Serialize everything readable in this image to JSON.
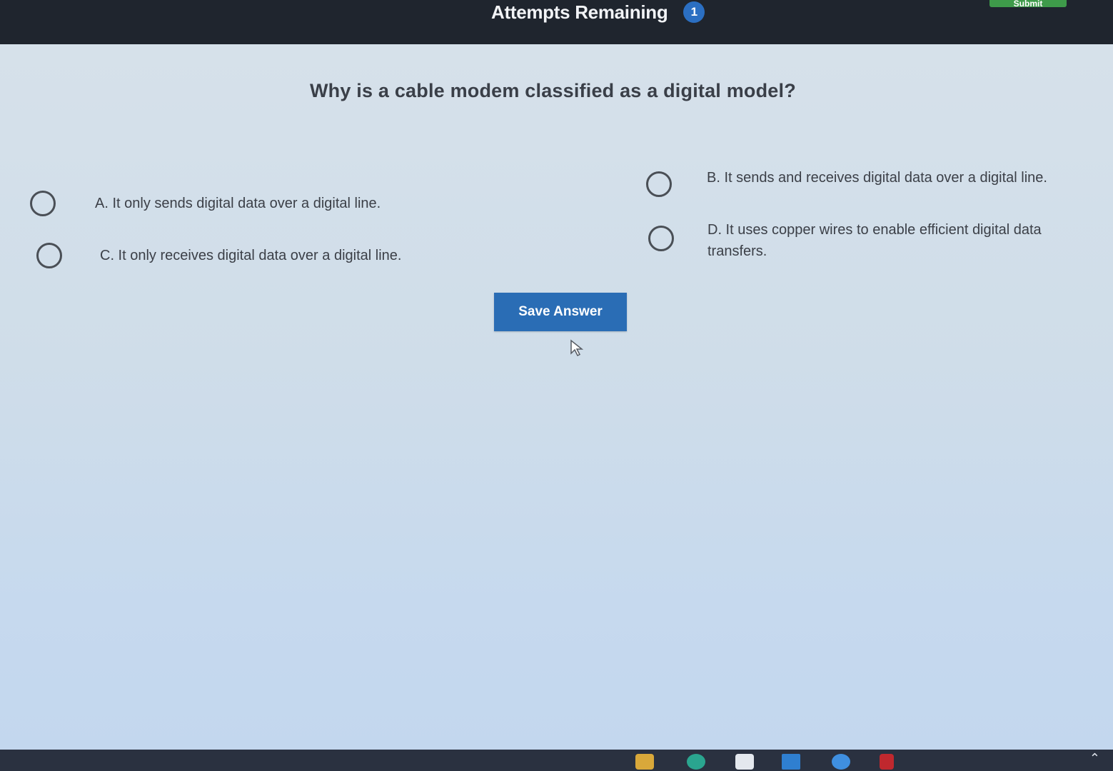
{
  "header": {
    "attempts_label": "Attempts Remaining",
    "attempts_count": "1",
    "submit_label": "Submit"
  },
  "question": {
    "text": "Why is a cable modem classified as a digital model?"
  },
  "options": [
    {
      "letter": "A",
      "text": "A. It only sends digital data over a digital line.",
      "selected": false
    },
    {
      "letter": "B",
      "text": "B. It sends and receives digital data over a digital line.",
      "selected": false
    },
    {
      "letter": "C",
      "text": "C. It only receives digital data over a digital line.",
      "selected": false
    },
    {
      "letter": "D",
      "text": "D. It uses copper wires to enable efficient digital data transfers.",
      "selected": false
    }
  ],
  "actions": {
    "save_label": "Save Answer"
  },
  "colors": {
    "header_bg": "#1f252e",
    "badge": "#2b6fc2",
    "submit": "#3e9b4a",
    "save_button": "#2a6db5",
    "content_bg": "#d3dfea"
  },
  "taskbar": {
    "icons": [
      "folder-icon",
      "edge-icon",
      "store-icon",
      "mydigital-icon",
      "chat-icon",
      "mcafee-icon"
    ]
  }
}
